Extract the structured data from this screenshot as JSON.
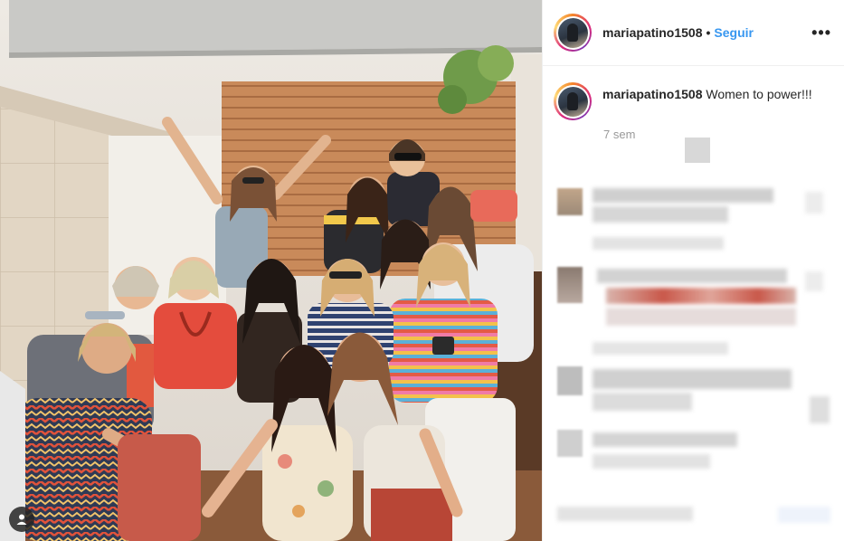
{
  "post": {
    "username": "mariapatino1508",
    "separator": "•",
    "follow_label": "Seguir",
    "more_label": "•••"
  },
  "caption": {
    "username": "mariapatino1508",
    "text": "Women to power!!!",
    "time": "7 sem"
  },
  "icons": {
    "more": "more-options-icon",
    "tag": "user-tag-icon"
  },
  "colors": {
    "accent": "#3897f0",
    "text": "#262626",
    "muted": "#999999",
    "border": "#efefef"
  }
}
